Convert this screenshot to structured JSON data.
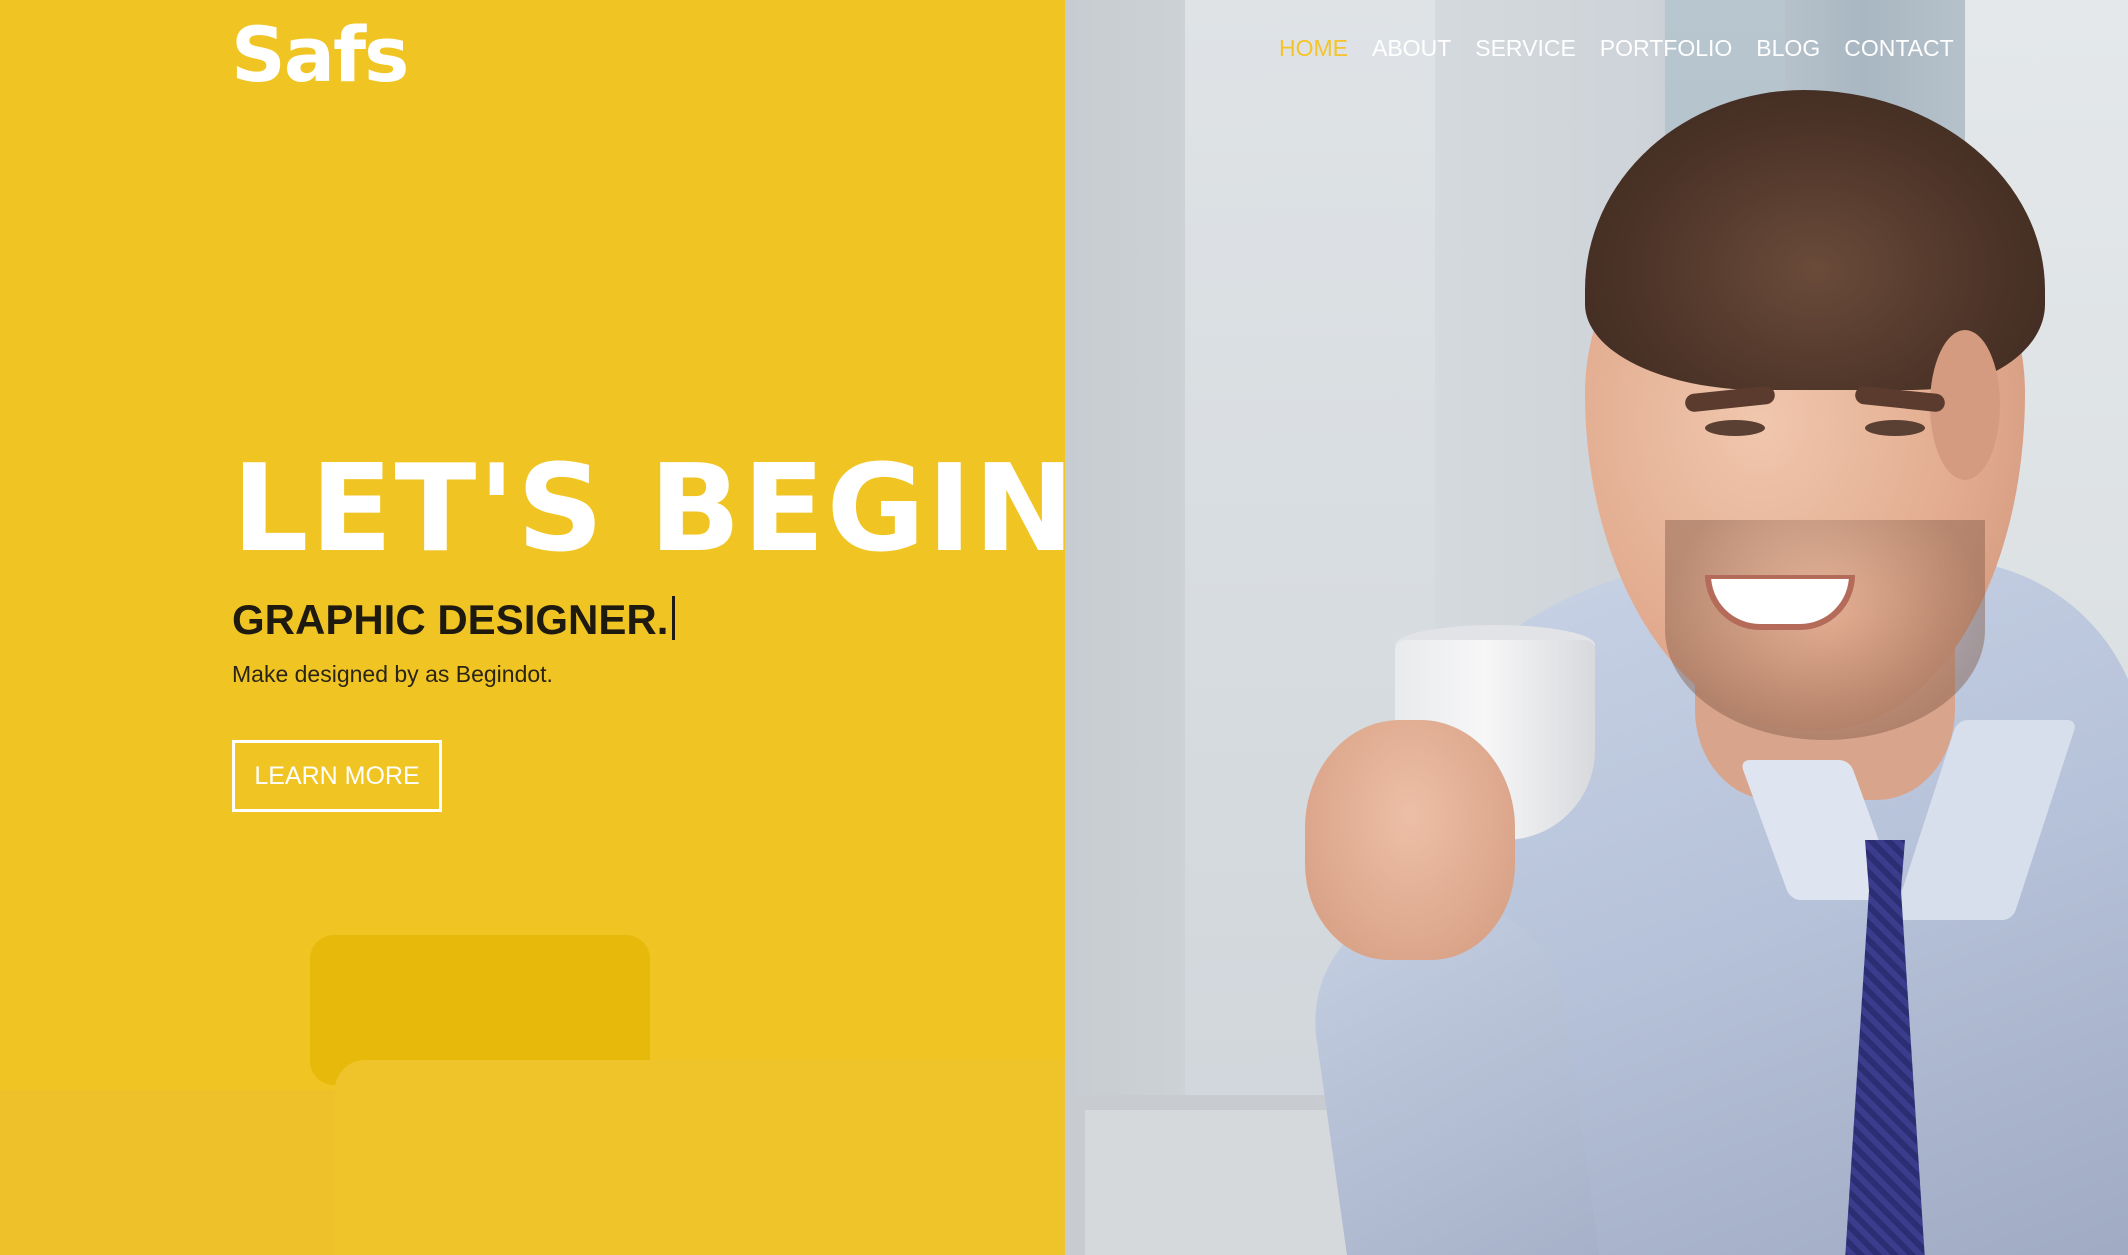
{
  "header": {
    "logo": "Safs",
    "nav": [
      {
        "label": "HOME",
        "active": true
      },
      {
        "label": "ABOUT",
        "active": false
      },
      {
        "label": "SERVICE",
        "active": false
      },
      {
        "label": "PORTFOLIO",
        "active": false
      },
      {
        "label": "BLOG",
        "active": false
      },
      {
        "label": "CONTACT",
        "active": false
      }
    ]
  },
  "hero": {
    "title": "LET'S BEGIN",
    "subtitle": "GRAPHIC DESIGNER.",
    "description": "Make designed by as Begindot.",
    "button_label": "LEARN MORE"
  },
  "colors": {
    "accent_yellow": "#f0c523",
    "nav_active": "#f4c42a",
    "text_light": "#ffffff",
    "text_dark": "#1f1a10"
  }
}
